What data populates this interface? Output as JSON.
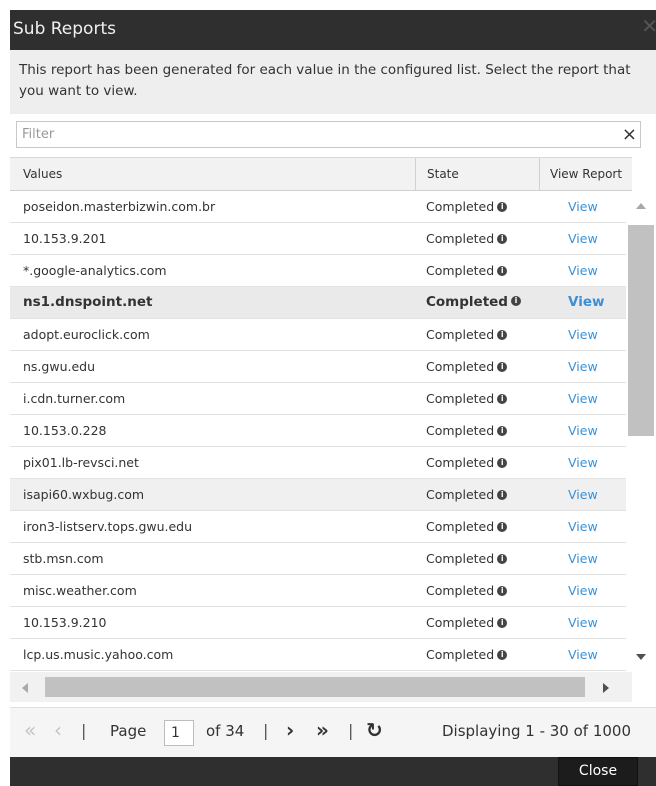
{
  "dialog": {
    "title": "Sub Reports",
    "close_icon": "close-icon",
    "description": "This report has been generated for each value in the configured list. Select the report that you want to view."
  },
  "filter": {
    "placeholder": "Filter",
    "value": "",
    "clear_icon": "×"
  },
  "table": {
    "columns": [
      "Values",
      "State",
      "View Report"
    ],
    "rows": [
      {
        "value": "poseidon.masterbizwin.com.br",
        "state": "Completed",
        "action": "View"
      },
      {
        "value": "10.153.9.201",
        "state": "Completed",
        "action": "View"
      },
      {
        "value": "*.google-analytics.com",
        "state": "Completed",
        "action": "View"
      },
      {
        "value": "ns1.dnspoint.net",
        "state": "Completed",
        "action": "View"
      },
      {
        "value": "adopt.euroclick.com",
        "state": "Completed",
        "action": "View"
      },
      {
        "value": "ns.gwu.edu",
        "state": "Completed",
        "action": "View"
      },
      {
        "value": "i.cdn.turner.com",
        "state": "Completed",
        "action": "View"
      },
      {
        "value": "10.153.0.228",
        "state": "Completed",
        "action": "View"
      },
      {
        "value": "pix01.lb-revsci.net",
        "state": "Completed",
        "action": "View"
      },
      {
        "value": "isapi60.wxbug.com",
        "state": "Completed",
        "action": "View"
      },
      {
        "value": "iron3-listserv.tops.gwu.edu",
        "state": "Completed",
        "action": "View"
      },
      {
        "value": "stb.msn.com",
        "state": "Completed",
        "action": "View"
      },
      {
        "value": "misc.weather.com",
        "state": "Completed",
        "action": "View"
      },
      {
        "value": "10.153.9.210",
        "state": "Completed",
        "action": "View"
      },
      {
        "value": "lcp.us.music.yahoo.com",
        "state": "Completed",
        "action": "View"
      }
    ],
    "info_glyph": "i"
  },
  "pager": {
    "page_label": "Page",
    "current_page": "1",
    "of_label": "of 34",
    "summary": "Displaying 1 - 30 of 1000",
    "first_glyph": "«",
    "prev_glyph": "‹",
    "next_glyph": "›",
    "last_glyph": "»",
    "refresh_glyph": "↻",
    "sep": "|"
  },
  "footer": {
    "close_label": "Close"
  },
  "colors": {
    "titlebar": "#2f2f2f",
    "link": "#3a8fd6",
    "selected_row": "#eaeaea"
  }
}
